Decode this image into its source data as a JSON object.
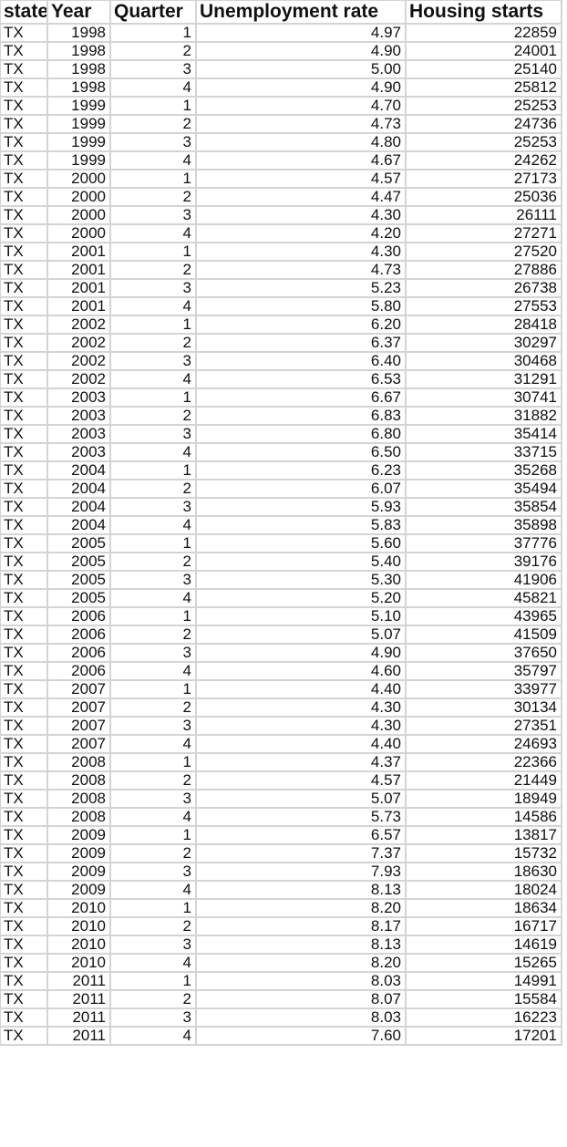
{
  "sheet": {
    "headers": [
      "state",
      "Year",
      "Quarter",
      "Unemployment rate",
      "Housing starts"
    ],
    "rows": [
      [
        "TX",
        "1998",
        "1",
        "4.97",
        "22859"
      ],
      [
        "TX",
        "1998",
        "2",
        "4.90",
        "24001"
      ],
      [
        "TX",
        "1998",
        "3",
        "5.00",
        "25140"
      ],
      [
        "TX",
        "1998",
        "4",
        "4.90",
        "25812"
      ],
      [
        "TX",
        "1999",
        "1",
        "4.70",
        "25253"
      ],
      [
        "TX",
        "1999",
        "2",
        "4.73",
        "24736"
      ],
      [
        "TX",
        "1999",
        "3",
        "4.80",
        "25253"
      ],
      [
        "TX",
        "1999",
        "4",
        "4.67",
        "24262"
      ],
      [
        "TX",
        "2000",
        "1",
        "4.57",
        "27173"
      ],
      [
        "TX",
        "2000",
        "2",
        "4.47",
        "25036"
      ],
      [
        "TX",
        "2000",
        "3",
        "4.30",
        "26111"
      ],
      [
        "TX",
        "2000",
        "4",
        "4.20",
        "27271"
      ],
      [
        "TX",
        "2001",
        "1",
        "4.30",
        "27520"
      ],
      [
        "TX",
        "2001",
        "2",
        "4.73",
        "27886"
      ],
      [
        "TX",
        "2001",
        "3",
        "5.23",
        "26738"
      ],
      [
        "TX",
        "2001",
        "4",
        "5.80",
        "27553"
      ],
      [
        "TX",
        "2002",
        "1",
        "6.20",
        "28418"
      ],
      [
        "TX",
        "2002",
        "2",
        "6.37",
        "30297"
      ],
      [
        "TX",
        "2002",
        "3",
        "6.40",
        "30468"
      ],
      [
        "TX",
        "2002",
        "4",
        "6.53",
        "31291"
      ],
      [
        "TX",
        "2003",
        "1",
        "6.67",
        "30741"
      ],
      [
        "TX",
        "2003",
        "2",
        "6.83",
        "31882"
      ],
      [
        "TX",
        "2003",
        "3",
        "6.80",
        "35414"
      ],
      [
        "TX",
        "2003",
        "4",
        "6.50",
        "33715"
      ],
      [
        "TX",
        "2004",
        "1",
        "6.23",
        "35268"
      ],
      [
        "TX",
        "2004",
        "2",
        "6.07",
        "35494"
      ],
      [
        "TX",
        "2004",
        "3",
        "5.93",
        "35854"
      ],
      [
        "TX",
        "2004",
        "4",
        "5.83",
        "35898"
      ],
      [
        "TX",
        "2005",
        "1",
        "5.60",
        "37776"
      ],
      [
        "TX",
        "2005",
        "2",
        "5.40",
        "39176"
      ],
      [
        "TX",
        "2005",
        "3",
        "5.30",
        "41906"
      ],
      [
        "TX",
        "2005",
        "4",
        "5.20",
        "45821"
      ],
      [
        "TX",
        "2006",
        "1",
        "5.10",
        "43965"
      ],
      [
        "TX",
        "2006",
        "2",
        "5.07",
        "41509"
      ],
      [
        "TX",
        "2006",
        "3",
        "4.90",
        "37650"
      ],
      [
        "TX",
        "2006",
        "4",
        "4.60",
        "35797"
      ],
      [
        "TX",
        "2007",
        "1",
        "4.40",
        "33977"
      ],
      [
        "TX",
        "2007",
        "2",
        "4.30",
        "30134"
      ],
      [
        "TX",
        "2007",
        "3",
        "4.30",
        "27351"
      ],
      [
        "TX",
        "2007",
        "4",
        "4.40",
        "24693"
      ],
      [
        "TX",
        "2008",
        "1",
        "4.37",
        "22366"
      ],
      [
        "TX",
        "2008",
        "2",
        "4.57",
        "21449"
      ],
      [
        "TX",
        "2008",
        "3",
        "5.07",
        "18949"
      ],
      [
        "TX",
        "2008",
        "4",
        "5.73",
        "14586"
      ],
      [
        "TX",
        "2009",
        "1",
        "6.57",
        "13817"
      ],
      [
        "TX",
        "2009",
        "2",
        "7.37",
        "15732"
      ],
      [
        "TX",
        "2009",
        "3",
        "7.93",
        "18630"
      ],
      [
        "TX",
        "2009",
        "4",
        "8.13",
        "18024"
      ],
      [
        "TX",
        "2010",
        "1",
        "8.20",
        "18634"
      ],
      [
        "TX",
        "2010",
        "2",
        "8.17",
        "16717"
      ],
      [
        "TX",
        "2010",
        "3",
        "8.13",
        "14619"
      ],
      [
        "TX",
        "2010",
        "4",
        "8.20",
        "15265"
      ],
      [
        "TX",
        "2011",
        "1",
        "8.03",
        "14991"
      ],
      [
        "TX",
        "2011",
        "2",
        "8.07",
        "15584"
      ],
      [
        "TX",
        "2011",
        "3",
        "8.03",
        "16223"
      ],
      [
        "TX",
        "2011",
        "4",
        "7.60",
        "17201"
      ]
    ]
  },
  "colors": {
    "gridline": "#d4d4d4",
    "text": "#111111",
    "background": "#ffffff"
  }
}
